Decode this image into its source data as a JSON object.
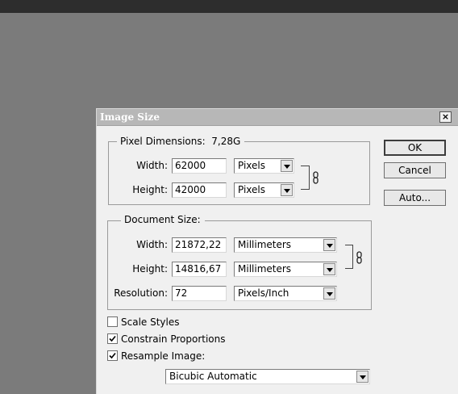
{
  "dialog": {
    "title": "Image Size",
    "close_glyph": "×"
  },
  "pixel_dimensions": {
    "label": "Pixel Dimensions:",
    "size": "7,28G",
    "width_label": "Width:",
    "width_value": "62000",
    "width_unit": "Pixels",
    "height_label": "Height:",
    "height_value": "42000",
    "height_unit": "Pixels"
  },
  "document_size": {
    "label": "Document Size:",
    "width_label": "Width:",
    "width_value": "21872,22",
    "width_unit": "Millimeters",
    "height_label": "Height:",
    "height_value": "14816,67",
    "height_unit": "Millimeters",
    "resolution_label": "Resolution:",
    "resolution_value": "72",
    "resolution_unit": "Pixels/Inch"
  },
  "buttons": {
    "ok": "OK",
    "cancel": "Cancel",
    "auto": "Auto..."
  },
  "options": {
    "scale_styles": {
      "label": "Scale Styles",
      "checked": false
    },
    "constrain_proportions": {
      "label": "Constrain Proportions",
      "checked": true
    },
    "resample_image": {
      "label": "Resample Image:",
      "checked": true
    },
    "resample_method": "Bicubic Automatic"
  },
  "icons": {
    "chain": "chain-link-icon",
    "dropdown": "chevron-down-icon",
    "close": "close-icon"
  }
}
